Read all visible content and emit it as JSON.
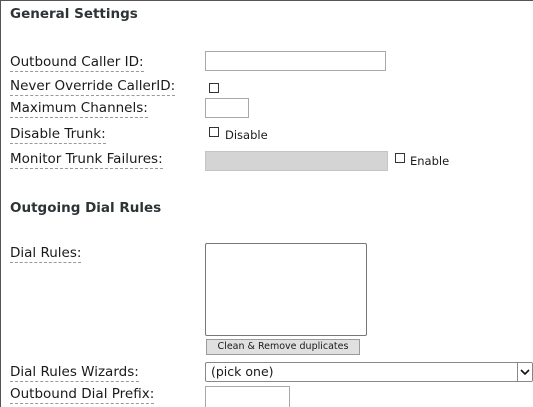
{
  "general": {
    "title": "General Settings",
    "outbound_caller_id": {
      "label": "Outbound Caller ID:",
      "value": ""
    },
    "never_override": {
      "label": "Never Override CallerID:",
      "checked": false
    },
    "max_channels": {
      "label": "Maximum Channels:",
      "value": ""
    },
    "disable_trunk": {
      "label": "Disable Trunk:",
      "checkbox_label": "Disable",
      "checked": false
    },
    "monitor_failures": {
      "label": "Monitor Trunk Failures:",
      "value": "",
      "checkbox_label": "Enable",
      "checked": false
    }
  },
  "dial_rules": {
    "title": "Outgoing Dial Rules",
    "rules": {
      "label": "Dial Rules:",
      "value": ""
    },
    "clean_button": "Clean & Remove duplicates",
    "wizards": {
      "label": "Dial Rules Wizards:",
      "selected": "(pick one)"
    },
    "prefix": {
      "label": "Outbound Dial Prefix:",
      "value": ""
    }
  },
  "icons": {
    "select_arrow": "chevron-down-icon"
  }
}
